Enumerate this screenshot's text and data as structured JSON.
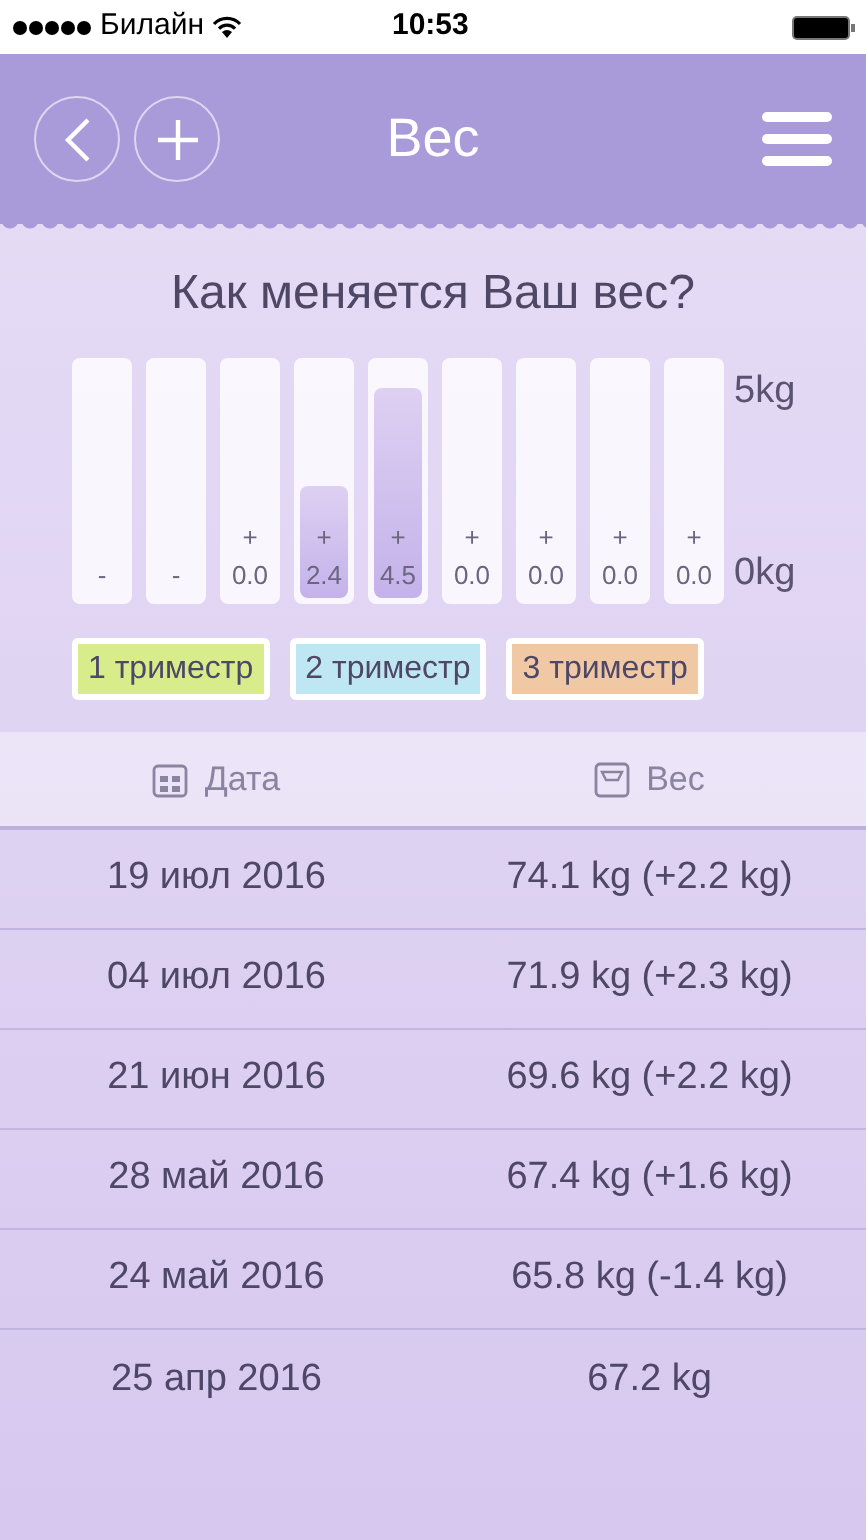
{
  "status_bar": {
    "carrier": "Билайн",
    "time": "10:53"
  },
  "header": {
    "title": "Вес"
  },
  "chart": {
    "title": "Как меняется Ваш вес?",
    "axis_top": "5kg",
    "axis_bottom": "0kg",
    "bars": [
      {
        "value": "-"
      },
      {
        "value": "-"
      },
      {
        "sign": "+",
        "value": "0.0"
      },
      {
        "sign": "+",
        "value": "2.4",
        "level": 0.48
      },
      {
        "sign": "+",
        "value": "4.5",
        "level": 0.9
      },
      {
        "sign": "+",
        "value": "0.0"
      },
      {
        "sign": "+",
        "value": "0.0"
      },
      {
        "sign": "+",
        "value": "0.0"
      },
      {
        "sign": "+",
        "value": "0.0"
      }
    ]
  },
  "legend": [
    {
      "label": "1 триместр",
      "color": "#d8ec8c"
    },
    {
      "label": "2 триместр",
      "color": "#bfe6f3"
    },
    {
      "label": "3 триместр",
      "color": "#f0c9a4"
    }
  ],
  "table": {
    "columns": [
      "Дата",
      "Вес"
    ],
    "rows": [
      [
        "19 июл 2016",
        "74.1 kg (+2.2 kg)"
      ],
      [
        "04 июл 2016",
        "71.9 kg (+2.3 kg)"
      ],
      [
        "21 июн 2016",
        "69.6 kg (+2.2 kg)"
      ],
      [
        "28 май 2016",
        "67.4 kg (+1.6 kg)"
      ],
      [
        "24 май 2016",
        "65.8 kg (-1.4 kg)"
      ],
      [
        "25 апр 2016",
        "67.2 kg"
      ]
    ]
  }
}
